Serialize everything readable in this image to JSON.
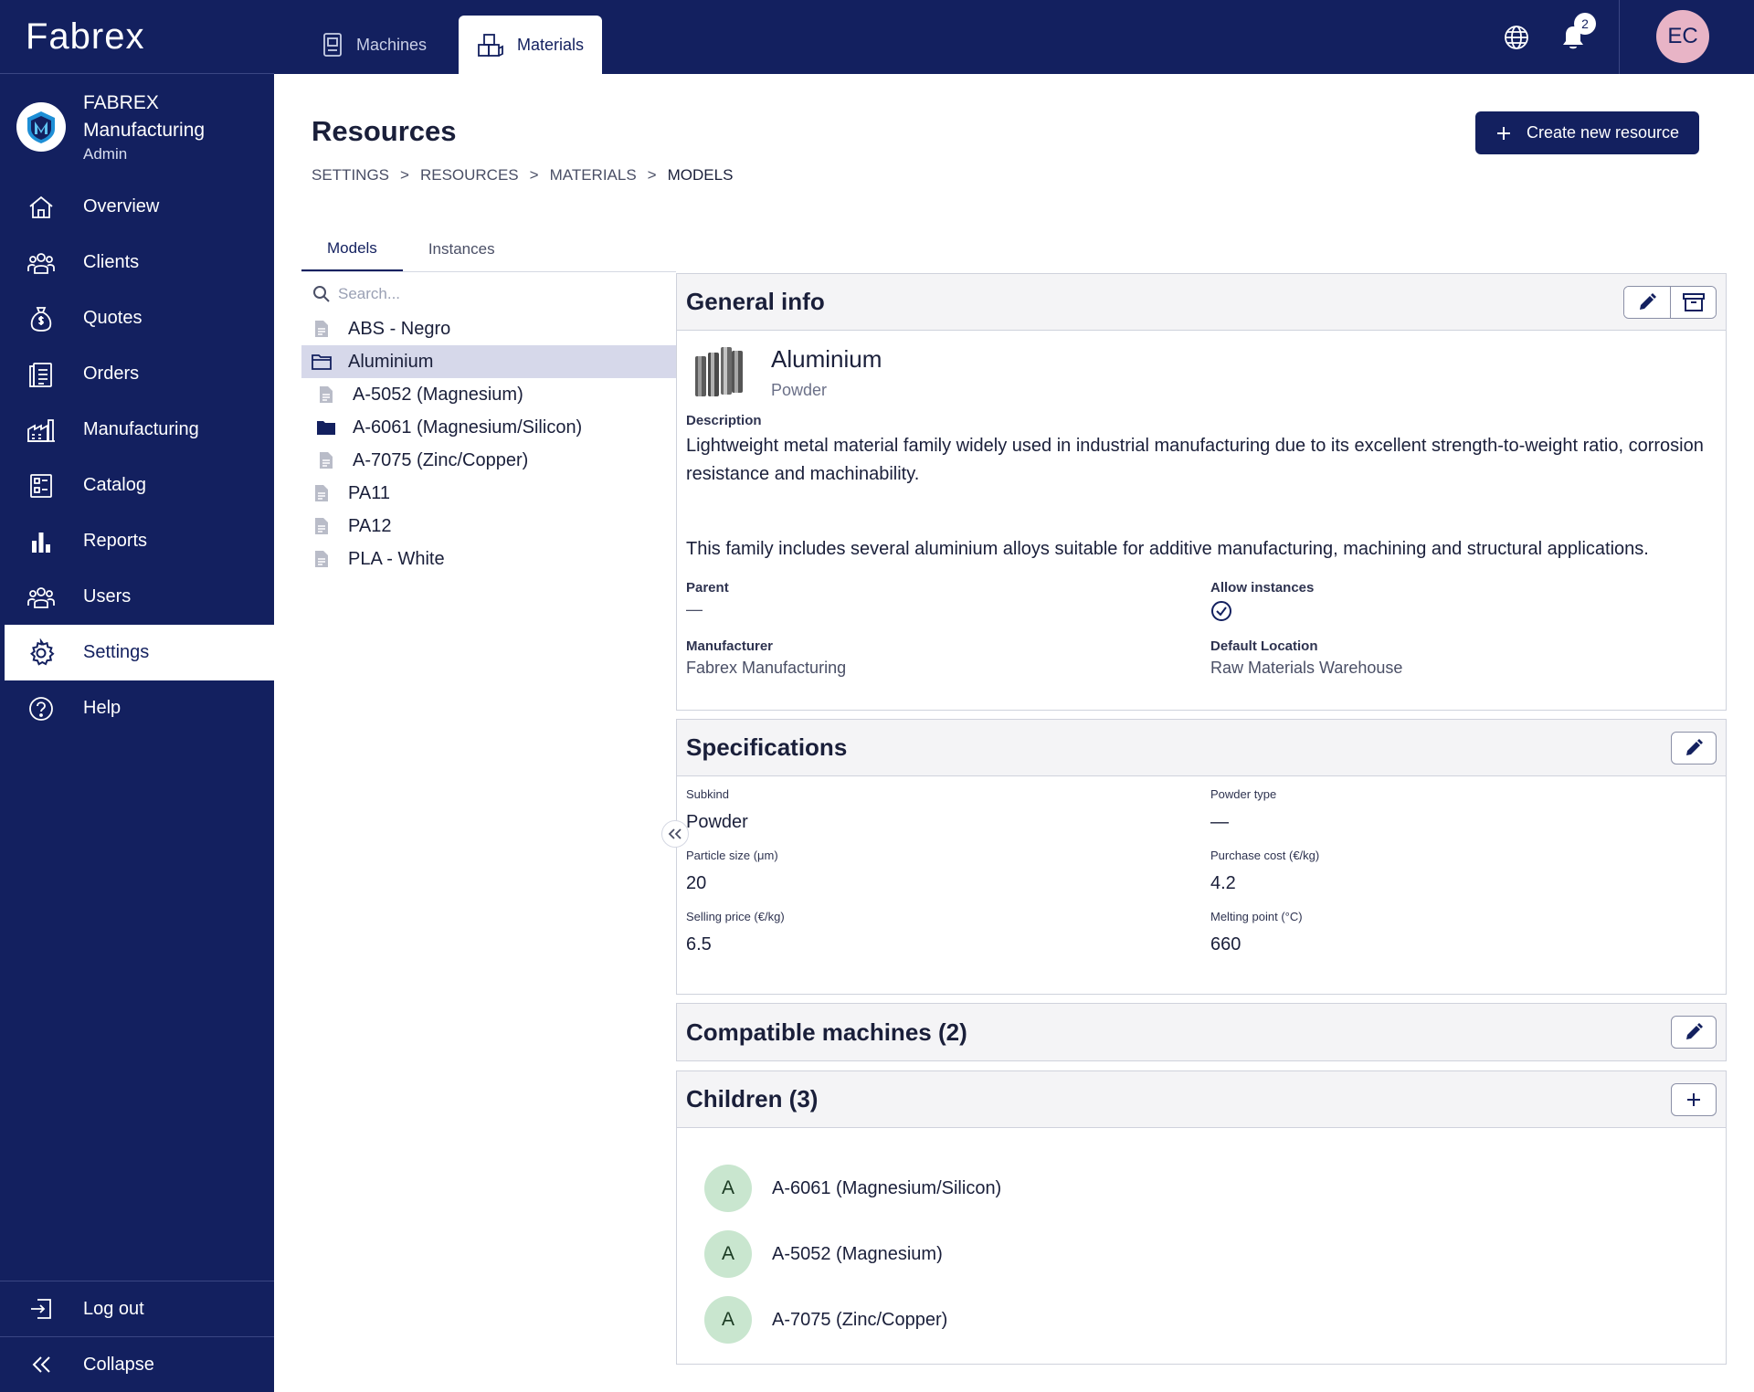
{
  "brand": {
    "name": "Fabrex"
  },
  "org": {
    "name_line1": "FABREX",
    "name_line2": "Manufacturing",
    "role": "Admin"
  },
  "sidebar": {
    "items": [
      {
        "label": "Overview",
        "icon": "home-icon"
      },
      {
        "label": "Clients",
        "icon": "people-icon"
      },
      {
        "label": "Quotes",
        "icon": "money-bag-icon"
      },
      {
        "label": "Orders",
        "icon": "clipboard-icon"
      },
      {
        "label": "Manufacturing",
        "icon": "factory-icon"
      },
      {
        "label": "Catalog",
        "icon": "catalog-icon"
      },
      {
        "label": "Reports",
        "icon": "bar-chart-icon"
      },
      {
        "label": "Users",
        "icon": "people-icon"
      },
      {
        "label": "Settings",
        "icon": "gear-icon",
        "active": true
      },
      {
        "label": "Help",
        "icon": "help-icon"
      }
    ],
    "logout_label": "Log out",
    "collapse_label": "Collapse"
  },
  "topbar": {
    "tabs": [
      {
        "label": "Machines",
        "icon": "machine-icon"
      },
      {
        "label": "Materials",
        "icon": "boxes-icon",
        "active": true
      }
    ],
    "notifications_count": "2",
    "avatar_initials": "EC"
  },
  "page": {
    "title": "Resources",
    "breadcrumb": [
      "SETTINGS",
      "RESOURCES",
      "MATERIALS",
      "MODELS"
    ],
    "breadcrumb_separator": ">",
    "create_button_label": "Create new resource"
  },
  "tabs": [
    {
      "label": "Models",
      "active": true
    },
    {
      "label": "Instances"
    }
  ],
  "tree": {
    "search_placeholder": "Search...",
    "items": [
      {
        "label": "ABS - Negro",
        "type": "file",
        "level": 0
      },
      {
        "label": "Aluminium",
        "type": "folder-open",
        "level": 0,
        "selected": true
      },
      {
        "label": "A-5052 (Magnesium)",
        "type": "file",
        "level": 1
      },
      {
        "label": "A-6061 (Magnesium/Silicon)",
        "type": "folder",
        "level": 1
      },
      {
        "label": "A-7075 (Zinc/Copper)",
        "type": "file",
        "level": 1
      },
      {
        "label": "PA11",
        "type": "file",
        "level": 0
      },
      {
        "label": "PA12",
        "type": "file",
        "level": 0
      },
      {
        "label": "PLA - White",
        "type": "file",
        "level": 0
      }
    ]
  },
  "general_info": {
    "title": "General info",
    "name": "Aluminium",
    "kind": "Powder",
    "description_label": "Description",
    "description_p1": "Lightweight metal material family widely used in industrial manufacturing due to its excellent strength-to-weight ratio, corrosion resistance and machinability.",
    "description_p2": "This family includes several aluminium alloys suitable for additive manufacturing, machining and structural applications.",
    "parent_label": "Parent",
    "parent_value": "—",
    "allow_instances_label": "Allow instances",
    "manufacturer_label": "Manufacturer",
    "manufacturer_value": "Fabrex Manufacturing",
    "default_location_label": "Default Location",
    "default_location_value": "Raw Materials Warehouse"
  },
  "specifications": {
    "title": "Specifications",
    "fields": [
      {
        "label": "Subkind",
        "value": "Powder"
      },
      {
        "label": "Powder type",
        "value": "—"
      },
      {
        "label": "Particle size (μm)",
        "value": "20"
      },
      {
        "label": "Purchase cost (€/kg)",
        "value": "4.2"
      },
      {
        "label": "Selling price (€/kg)",
        "value": "6.5"
      },
      {
        "label": "Melting point (°C)",
        "value": "660"
      }
    ]
  },
  "compatible_machines": {
    "title": "Compatible machines (2)"
  },
  "children": {
    "title": "Children (3)",
    "items": [
      {
        "initial": "A",
        "name": "A-6061 (Magnesium/Silicon)"
      },
      {
        "initial": "A",
        "name": "A-5052 (Magnesium)"
      },
      {
        "initial": "A",
        "name": "A-7075 (Zinc/Copper)"
      }
    ]
  },
  "colors": {
    "navy": "#13205f",
    "selected_row": "#d6d8ea",
    "child_avatar": "#c9e6cf",
    "user_avatar": "#e8b4c6"
  }
}
